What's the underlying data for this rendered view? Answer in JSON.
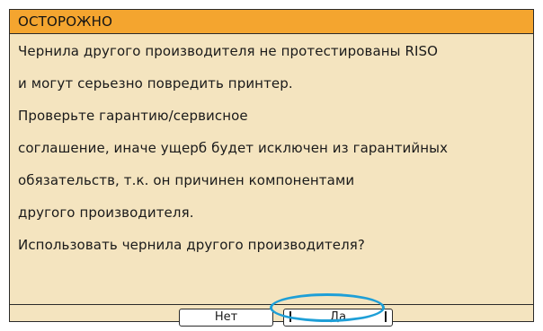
{
  "dialog": {
    "title": "ОСТОРОЖНО",
    "lines": [
      "Чернила другого производителя не протестированы RISO",
      "и могут серьезно повредить принтер.",
      "Проверьте гарантию/сервисное",
      "соглашение, иначе ущерб будет исключен из гарантийных",
      "обязательств, т.к. он причинен компонентами",
      "другого производителя.",
      "Использовать чернила другого производителя?"
    ],
    "buttons": {
      "no_label": "Нет",
      "yes_label": "Да"
    },
    "colors": {
      "title_bar": "#f4a52f",
      "body": "#f4e4bf",
      "focus": "#1e9fd7"
    }
  }
}
